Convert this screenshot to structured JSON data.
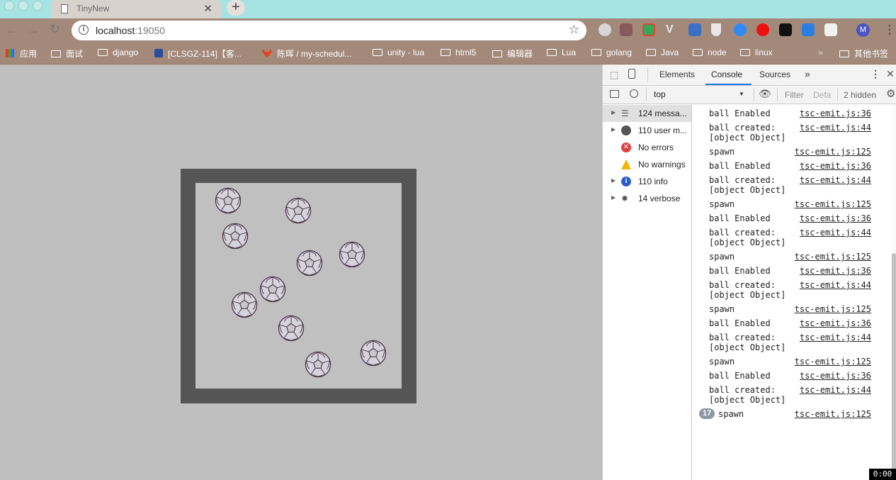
{
  "browser": {
    "tab_title": "TinyNew",
    "tab_close": "✕",
    "new_tab": "+",
    "url_host": "localhost",
    "url_port": ":19050",
    "profile_initial": "M"
  },
  "bookmarks": [
    {
      "label": "应用",
      "type": "apps"
    },
    {
      "label": "面试",
      "type": "folder"
    },
    {
      "label": "django",
      "type": "folder"
    },
    {
      "label": "[CLSGZ-114]【客...",
      "type": "page"
    },
    {
      "label": "陈晖 / my-schedul...",
      "type": "page"
    },
    {
      "label": "unity - lua",
      "type": "folder"
    },
    {
      "label": "html5",
      "type": "folder"
    },
    {
      "label": "编辑器",
      "type": "folder"
    },
    {
      "label": "Lua",
      "type": "folder"
    },
    {
      "label": "golang",
      "type": "folder"
    },
    {
      "label": "Java",
      "type": "folder"
    },
    {
      "label": "node",
      "type": "folder"
    },
    {
      "label": "linux",
      "type": "folder"
    }
  ],
  "bookmarks_overflow": "»",
  "other_bookmarks": "其他书签",
  "devtools": {
    "tabs": [
      "Elements",
      "Console",
      "Sources"
    ],
    "more_tabs": "»",
    "context": "top",
    "filter_placeholder": "Filter",
    "levels": "Defa",
    "hidden": "2 hidden",
    "sidebar": [
      {
        "label": "124 messa...",
        "icon": "list-icon",
        "expandable": true
      },
      {
        "label": "110 user m...",
        "icon": "user-icon",
        "expandable": true
      },
      {
        "label": "No errors",
        "icon": "error-icon",
        "expandable": false
      },
      {
        "label": "No warnings",
        "icon": "warning-icon",
        "expandable": false
      },
      {
        "label": "110 info",
        "icon": "info-icon",
        "expandable": true
      },
      {
        "label": "14 verbose",
        "icon": "bug-icon",
        "expandable": true
      }
    ],
    "messages": [
      {
        "text": "ball Enabled",
        "source": "tsc-emit.js:36"
      },
      {
        "text": "ball created:\n[object Object]",
        "source": "tsc-emit.js:44"
      },
      {
        "text": "spawn",
        "source": "tsc-emit.js:125"
      },
      {
        "text": "ball Enabled",
        "source": "tsc-emit.js:36"
      },
      {
        "text": "ball created:\n[object Object]",
        "source": "tsc-emit.js:44"
      },
      {
        "text": "spawn",
        "source": "tsc-emit.js:125"
      },
      {
        "text": "ball Enabled",
        "source": "tsc-emit.js:36"
      },
      {
        "text": "ball created:\n[object Object]",
        "source": "tsc-emit.js:44"
      },
      {
        "text": "spawn",
        "source": "tsc-emit.js:125"
      },
      {
        "text": "ball Enabled",
        "source": "tsc-emit.js:36"
      },
      {
        "text": "ball created:\n[object Object]",
        "source": "tsc-emit.js:44"
      },
      {
        "text": "spawn",
        "source": "tsc-emit.js:125"
      },
      {
        "text": "ball Enabled",
        "source": "tsc-emit.js:36"
      },
      {
        "text": "ball created:\n[object Object]",
        "source": "tsc-emit.js:44"
      },
      {
        "text": "spawn",
        "source": "tsc-emit.js:125"
      },
      {
        "text": "ball Enabled",
        "source": "tsc-emit.js:36"
      },
      {
        "text": "ball created:\n[object Object]",
        "source": "tsc-emit.js:44"
      },
      {
        "text": "spawn",
        "source": "tsc-emit.js:125",
        "count": "17"
      }
    ]
  },
  "timer": "0:00",
  "colors": {
    "tabstrip": "#a6e3e3",
    "toolbar": "#a3897a",
    "arena_border": "#555555",
    "arena_floor": "#c0c0c0"
  }
}
